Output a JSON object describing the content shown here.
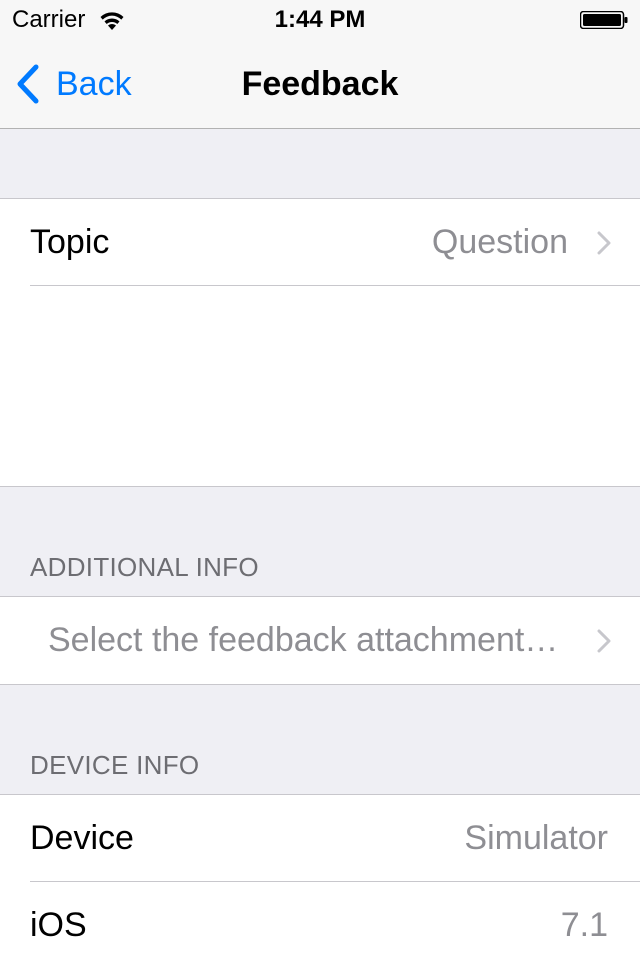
{
  "status_bar": {
    "carrier": "Carrier",
    "time": "1:44 PM",
    "wifi_icon": "wifi-icon",
    "battery_icon": "battery-icon"
  },
  "nav_bar": {
    "back_label": "Back",
    "title": "Feedback",
    "accent_color": "#007aff"
  },
  "topic_section": {
    "label": "Topic",
    "value": "Question"
  },
  "additional_info": {
    "header": "ADDITIONAL INFO",
    "placeholder": "Select the feedback attachment…"
  },
  "device_info": {
    "header": "DEVICE INFO",
    "rows": [
      {
        "label": "Device",
        "value": "Simulator"
      },
      {
        "label": "iOS",
        "value": "7.1"
      }
    ]
  }
}
